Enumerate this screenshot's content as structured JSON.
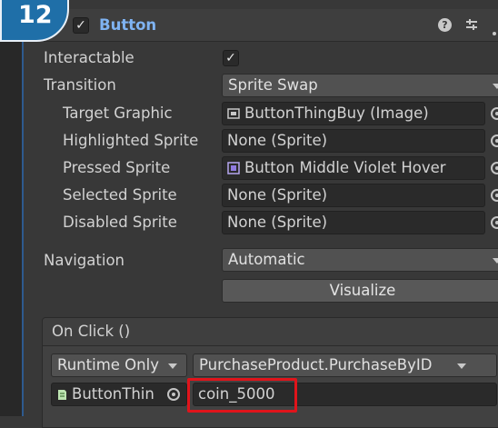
{
  "badge": {
    "number": "12",
    "color": "#1f6fa8"
  },
  "component": {
    "title": "Button",
    "enabled": true,
    "help_glyph": "?",
    "title_color": "#7fb3f2"
  },
  "properties": {
    "interactable": {
      "label": "Interactable",
      "checked": true,
      "check_glyph": "✓"
    },
    "transition": {
      "label": "Transition",
      "value": "Sprite Swap"
    },
    "target_graphic": {
      "label": "Target Graphic",
      "value": "ButtonThingBuy (Image)"
    },
    "highlighted_sprite": {
      "label": "Highlighted Sprite",
      "value": "None (Sprite)"
    },
    "pressed_sprite": {
      "label": "Pressed Sprite",
      "value": "Button Middle Violet Hover"
    },
    "selected_sprite": {
      "label": "Selected Sprite",
      "value": "None (Sprite)"
    },
    "disabled_sprite": {
      "label": "Disabled Sprite",
      "value": "None (Sprite)"
    },
    "navigation": {
      "label": "Navigation",
      "value": "Automatic"
    },
    "visualize_button": "Visualize"
  },
  "on_click": {
    "header": "On Click ()",
    "runtime_option": "Runtime Only",
    "function": "PurchaseProduct.PurchaseByID",
    "target_object": "ButtonThin",
    "argument": "coin_5000",
    "highlight_color": "#e0141b"
  }
}
